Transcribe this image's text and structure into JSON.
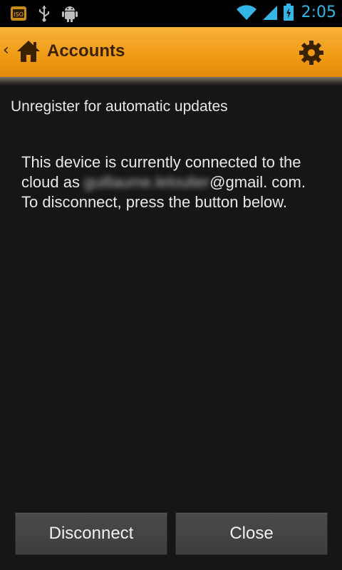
{
  "status_bar": {
    "time": "2:05",
    "icons": [
      "notification-app-icon",
      "usb-icon",
      "android-debug-icon",
      "wifi-icon",
      "signal-icon",
      "battery-charging-icon"
    ]
  },
  "action_bar": {
    "title": "Accounts",
    "icons": [
      "up-chevron-icon",
      "home-icon",
      "settings-gear-icon"
    ]
  },
  "content": {
    "subtitle": "Unregister for automatic updates",
    "message_prefix": "This device is currently connected to the cloud as ",
    "message_suffix": "@gmail. com. To disconnect, press the button below.",
    "redacted_email_local_part": "guillaume.leloulier"
  },
  "buttons": {
    "disconnect": "Disconnect",
    "close": "Close"
  },
  "colors": {
    "accent_orange": "#f0a020",
    "clock_blue": "#33b5e5",
    "background": "#161616"
  }
}
